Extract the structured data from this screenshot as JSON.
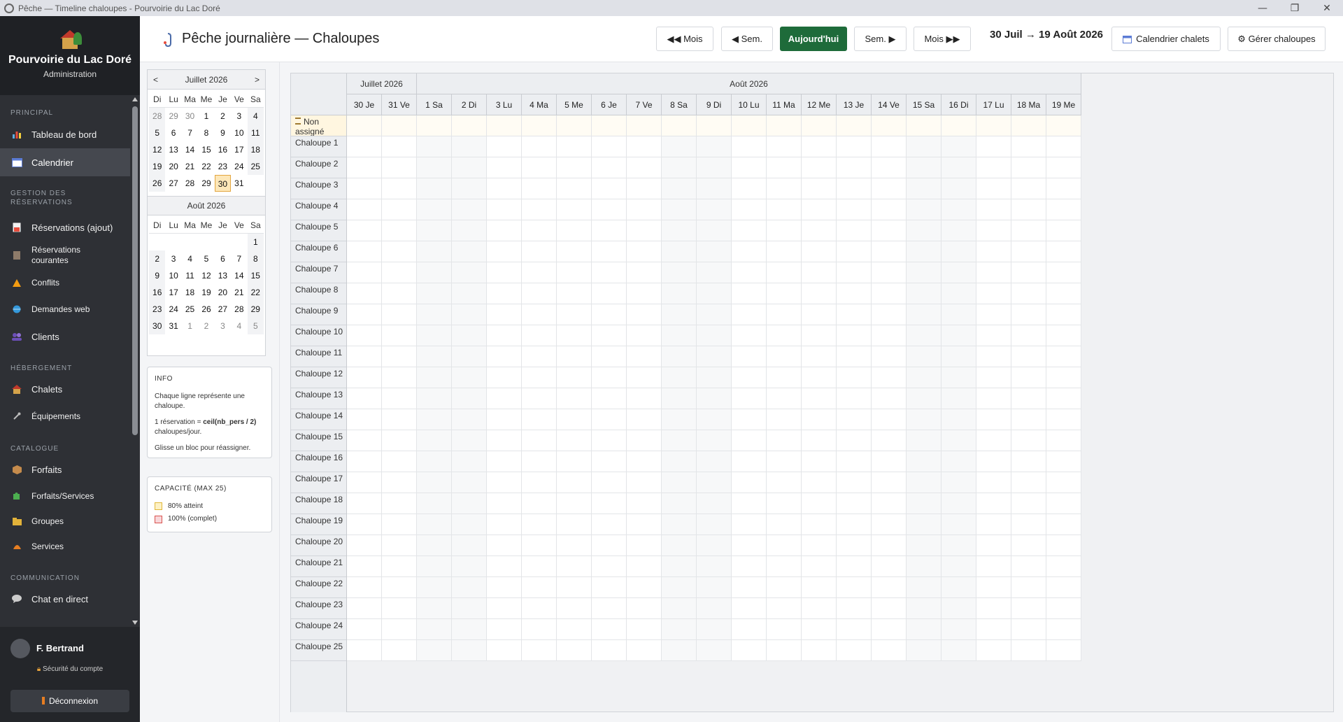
{
  "window": {
    "title": "Pêche — Timeline chaloupes - Pourvoirie du Lac Doré",
    "min": "—",
    "max": "❐",
    "close": "✕"
  },
  "brand": {
    "name": "Pourvoirie du Lac Doré",
    "subtitle": "Administration"
  },
  "nav": {
    "principal": "PRINCIPAL",
    "tableau": "Tableau de bord",
    "calendrier": "Calendrier",
    "gestion": "GESTION DES RÉSERVATIONS",
    "res_ajout": "Réservations (ajout)",
    "res_courantes": "Réservations courantes",
    "conflits": "Conflits",
    "demandes": "Demandes web",
    "clients": "Clients",
    "hebergement": "HÉBERGEMENT",
    "chalets": "Chalets",
    "equipements": "Équipements",
    "catalogue": "CATALOGUE",
    "forfaits": "Forfaits",
    "forfaits_services": "Forfaits/Services",
    "groupes": "Groupes",
    "services": "Services",
    "communication": "COMMUNICATION",
    "chat": "Chat en direct"
  },
  "user": {
    "name": "F. Bertrand",
    "security": "Sécurité du compte",
    "logout": "Déconnexion"
  },
  "header": {
    "title": "Pêche journalière — Chaloupes",
    "prev_month": "◀◀ Mois",
    "prev_week": "◀ Sem.",
    "today": "Aujourd'hui",
    "next_week": "Sem. ▶",
    "next_month": "Mois ▶▶",
    "range": "30 Juil → 19 Août 2026",
    "cal_chalets": "Calendrier chalets",
    "manage": "⚙ Gérer chaloupes"
  },
  "minical": {
    "prev": "<",
    "next": ">",
    "month1": "Juillet 2026",
    "month2": "Août 2026",
    "dow": [
      "Di",
      "Lu",
      "Ma",
      "Me",
      "Je",
      "Ve",
      "Sa"
    ],
    "july_days": [
      "28",
      "29",
      "30",
      "1",
      "2",
      "3",
      "4",
      "5",
      "6",
      "7",
      "8",
      "9",
      "10",
      "11",
      "12",
      "13",
      "14",
      "15",
      "16",
      "17",
      "18",
      "19",
      "20",
      "21",
      "22",
      "23",
      "24",
      "25",
      "26",
      "27",
      "28",
      "29",
      "30",
      "31"
    ],
    "aug_days": [
      "1",
      "2",
      "3",
      "4",
      "5",
      "6",
      "7",
      "8",
      "9",
      "10",
      "11",
      "12",
      "13",
      "14",
      "15",
      "16",
      "17",
      "18",
      "19",
      "20",
      "21",
      "22",
      "23",
      "24",
      "25",
      "26",
      "27",
      "28",
      "29",
      "30",
      "31",
      "1",
      "2",
      "3",
      "4",
      "5"
    ]
  },
  "info": {
    "title": "INFO",
    "line1": "Chaque ligne représente une chaloupe.",
    "line2a": "1 réservation = ",
    "line2b": "ceil(nb_pers / 2)",
    "line2c": " chaloupes/jour.",
    "line3": "Glisse un bloc pour réassigner."
  },
  "capacity": {
    "title": "CAPACITÉ (MAX 25)",
    "l80": "80% atteint",
    "l100": "100% (complet)",
    "c80": "#fdf1c4",
    "c100": "#f8d7da"
  },
  "timeline": {
    "months": [
      {
        "label": "Juillet 2026",
        "span": 2
      },
      {
        "label": "Août 2026",
        "span": 19
      }
    ],
    "days": [
      "30 Je",
      "31 Ve",
      "1 Sa",
      "2 Di",
      "3 Lu",
      "4 Ma",
      "5 Me",
      "6 Je",
      "7 Ve",
      "8 Sa",
      "9 Di",
      "10 Lu",
      "11 Ma",
      "12 Me",
      "13 Je",
      "14 Ve",
      "15 Sa",
      "16 Di",
      "17 Lu",
      "18 Ma",
      "19 Me"
    ],
    "weekend_idx": [
      2,
      3,
      9,
      10,
      16,
      17
    ],
    "rows": [
      "Non assigné",
      "Chaloupe 1",
      "Chaloupe 2",
      "Chaloupe 3",
      "Chaloupe 4",
      "Chaloupe 5",
      "Chaloupe 6",
      "Chaloupe 7",
      "Chaloupe 8",
      "Chaloupe 9",
      "Chaloupe 10",
      "Chaloupe 11",
      "Chaloupe 12",
      "Chaloupe 13",
      "Chaloupe 14",
      "Chaloupe 15",
      "Chaloupe 16",
      "Chaloupe 17",
      "Chaloupe 18",
      "Chaloupe 19",
      "Chaloupe 20",
      "Chaloupe 21",
      "Chaloupe 22",
      "Chaloupe 23",
      "Chaloupe 24",
      "Chaloupe 25"
    ]
  }
}
